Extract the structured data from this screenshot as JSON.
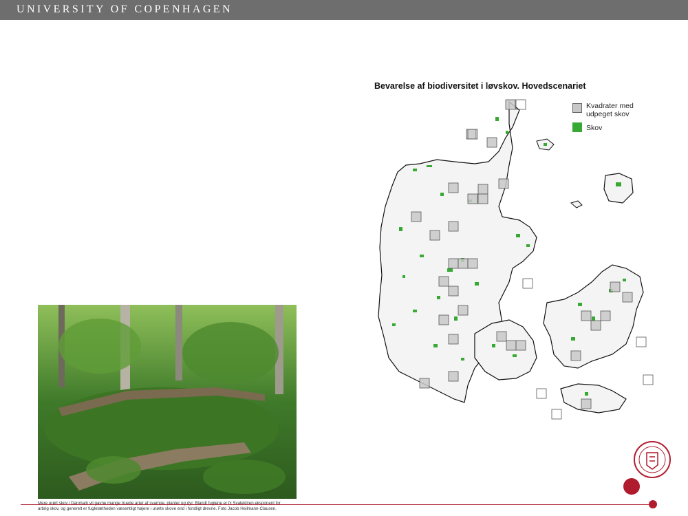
{
  "header": {
    "title": "UNIVERSITY OF COPENHAGEN"
  },
  "map": {
    "title": "Bevarelse af biodiversitet i løvskov. Hovedscenariet",
    "legend": [
      {
        "label_line1": "Kvadrater med",
        "label_line2": "udpeget skov",
        "color": "#c8c8c8"
      },
      {
        "label_line1": "Skov",
        "label_line2": "",
        "color": "#39a935"
      }
    ]
  },
  "photo": {
    "caption_line1": "Mere urørt skov i Danmark vil gavne mange truede arter af svampe, planter og dyr. Blandt fuglene er fx Svalekliren eksponent for",
    "caption_line2": "arbrig skov, og generelt er fugletætheden væsentligt højere i urørte skove end i forstligt drevne. Foto Jacob Heilmann-Clausen."
  },
  "colors": {
    "header_bg": "#6e6e6e",
    "accent_red": "#b01b2e",
    "forest_green": "#39a935",
    "square_grey": "#c8c8c8"
  }
}
